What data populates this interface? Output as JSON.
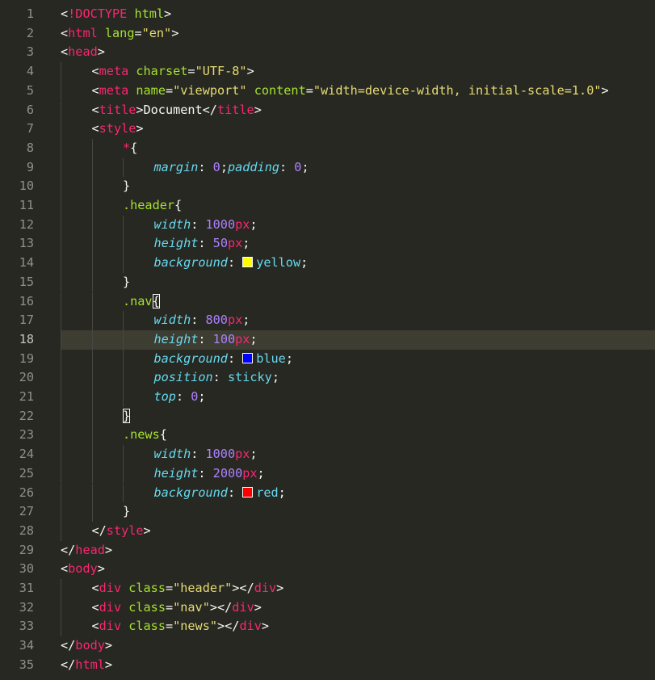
{
  "editor": {
    "active_line": 18,
    "colors": {
      "background": "#272822",
      "tag": "#f92672",
      "attribute": "#a6e22e",
      "string": "#e6db74",
      "number": "#ae81ff",
      "property": "#66d9ef",
      "text": "#f8f8f2"
    },
    "lines": [
      {
        "n": "1",
        "indent": 0,
        "tokens": [
          [
            "plain",
            "<"
          ],
          [
            "tag",
            "!DOCTYPE"
          ],
          [
            "plain",
            " "
          ],
          [
            "attr",
            "html"
          ],
          [
            "plain",
            ">"
          ]
        ]
      },
      {
        "n": "2",
        "indent": 0,
        "tokens": [
          [
            "plain",
            "<"
          ],
          [
            "tag",
            "html"
          ],
          [
            "plain",
            " "
          ],
          [
            "attr",
            "lang"
          ],
          [
            "plain",
            "="
          ],
          [
            "str",
            "\"en\""
          ],
          [
            "plain",
            ">"
          ]
        ]
      },
      {
        "n": "3",
        "indent": 0,
        "tokens": [
          [
            "plain",
            "<"
          ],
          [
            "tag",
            "head"
          ],
          [
            "plain",
            ">"
          ]
        ]
      },
      {
        "n": "4",
        "indent": 1,
        "tokens": [
          [
            "plain",
            "<"
          ],
          [
            "tag",
            "meta"
          ],
          [
            "plain",
            " "
          ],
          [
            "attr",
            "charset"
          ],
          [
            "plain",
            "="
          ],
          [
            "str",
            "\"UTF-8\""
          ],
          [
            "plain",
            ">"
          ]
        ]
      },
      {
        "n": "5",
        "indent": 1,
        "tokens": [
          [
            "plain",
            "<"
          ],
          [
            "tag",
            "meta"
          ],
          [
            "plain",
            " "
          ],
          [
            "attr",
            "name"
          ],
          [
            "plain",
            "="
          ],
          [
            "str",
            "\"viewport\""
          ],
          [
            "plain",
            " "
          ],
          [
            "attr",
            "content"
          ],
          [
            "plain",
            "="
          ],
          [
            "str",
            "\"width=device-width, initial-scale=1.0\""
          ],
          [
            "plain",
            ">"
          ]
        ]
      },
      {
        "n": "6",
        "indent": 1,
        "tokens": [
          [
            "plain",
            "<"
          ],
          [
            "tag",
            "title"
          ],
          [
            "plain",
            ">Document</"
          ],
          [
            "tag",
            "title"
          ],
          [
            "plain",
            ">"
          ]
        ]
      },
      {
        "n": "7",
        "indent": 1,
        "tokens": [
          [
            "plain",
            "<"
          ],
          [
            "tag",
            "style"
          ],
          [
            "plain",
            ">"
          ]
        ]
      },
      {
        "n": "8",
        "indent": 2,
        "tokens": [
          [
            "tag",
            "*"
          ],
          [
            "plain",
            "{"
          ]
        ]
      },
      {
        "n": "9",
        "indent": 3,
        "tokens": [
          [
            "prop",
            "margin"
          ],
          [
            "plain",
            ": "
          ],
          [
            "num",
            "0"
          ],
          [
            "plain",
            ";"
          ],
          [
            "prop",
            "padding"
          ],
          [
            "plain",
            ": "
          ],
          [
            "num",
            "0"
          ],
          [
            "plain",
            ";"
          ]
        ]
      },
      {
        "n": "10",
        "indent": 2,
        "tokens": [
          [
            "plain",
            "}"
          ]
        ]
      },
      {
        "n": "11",
        "indent": 2,
        "tokens": [
          [
            "sel",
            ".header"
          ],
          [
            "plain",
            "{"
          ]
        ]
      },
      {
        "n": "12",
        "indent": 3,
        "tokens": [
          [
            "prop",
            "width"
          ],
          [
            "plain",
            ": "
          ],
          [
            "num",
            "1000"
          ],
          [
            "unit",
            "px"
          ],
          [
            "plain",
            ";"
          ]
        ]
      },
      {
        "n": "13",
        "indent": 3,
        "tokens": [
          [
            "prop",
            "height"
          ],
          [
            "plain",
            ": "
          ],
          [
            "num",
            "50"
          ],
          [
            "unit",
            "px"
          ],
          [
            "plain",
            ";"
          ]
        ]
      },
      {
        "n": "14",
        "indent": 3,
        "tokens": [
          [
            "prop",
            "background"
          ],
          [
            "plain",
            ": "
          ],
          [
            "swatch",
            "#ffff00"
          ],
          [
            "kw",
            "yellow"
          ],
          [
            "plain",
            ";"
          ]
        ]
      },
      {
        "n": "15",
        "indent": 2,
        "tokens": [
          [
            "plain",
            "}"
          ]
        ]
      },
      {
        "n": "16",
        "indent": 2,
        "tokens": [
          [
            "sel",
            ".nav"
          ],
          [
            "box",
            "{"
          ]
        ]
      },
      {
        "n": "17",
        "indent": 3,
        "tokens": [
          [
            "prop",
            "width"
          ],
          [
            "plain",
            ": "
          ],
          [
            "num",
            "800"
          ],
          [
            "unit",
            "px"
          ],
          [
            "plain",
            ";"
          ]
        ]
      },
      {
        "n": "18",
        "indent": 3,
        "tokens": [
          [
            "prop",
            "height"
          ],
          [
            "plain",
            ": "
          ],
          [
            "num",
            "100"
          ],
          [
            "unit",
            "px"
          ],
          [
            "plain",
            ";"
          ]
        ]
      },
      {
        "n": "19",
        "indent": 3,
        "tokens": [
          [
            "prop",
            "background"
          ],
          [
            "plain",
            ": "
          ],
          [
            "swatch",
            "#0000ff"
          ],
          [
            "kw",
            "blue"
          ],
          [
            "plain",
            ";"
          ]
        ]
      },
      {
        "n": "20",
        "indent": 3,
        "tokens": [
          [
            "prop",
            "position"
          ],
          [
            "plain",
            ": "
          ],
          [
            "kw",
            "sticky"
          ],
          [
            "plain",
            ";"
          ]
        ]
      },
      {
        "n": "21",
        "indent": 3,
        "tokens": [
          [
            "prop",
            "top"
          ],
          [
            "plain",
            ": "
          ],
          [
            "num",
            "0"
          ],
          [
            "plain",
            ";"
          ]
        ]
      },
      {
        "n": "22",
        "indent": 2,
        "tokens": [
          [
            "box",
            "}"
          ]
        ]
      },
      {
        "n": "23",
        "indent": 2,
        "tokens": [
          [
            "sel",
            ".news"
          ],
          [
            "plain",
            "{"
          ]
        ]
      },
      {
        "n": "24",
        "indent": 3,
        "tokens": [
          [
            "prop",
            "width"
          ],
          [
            "plain",
            ": "
          ],
          [
            "num",
            "1000"
          ],
          [
            "unit",
            "px"
          ],
          [
            "plain",
            ";"
          ]
        ]
      },
      {
        "n": "25",
        "indent": 3,
        "tokens": [
          [
            "prop",
            "height"
          ],
          [
            "plain",
            ": "
          ],
          [
            "num",
            "2000"
          ],
          [
            "unit",
            "px"
          ],
          [
            "plain",
            ";"
          ]
        ]
      },
      {
        "n": "26",
        "indent": 3,
        "tokens": [
          [
            "prop",
            "background"
          ],
          [
            "plain",
            ": "
          ],
          [
            "swatch",
            "#ff0000"
          ],
          [
            "kw",
            "red"
          ],
          [
            "plain",
            ";"
          ]
        ]
      },
      {
        "n": "27",
        "indent": 2,
        "tokens": [
          [
            "plain",
            "}"
          ]
        ]
      },
      {
        "n": "28",
        "indent": 1,
        "tokens": [
          [
            "plain",
            "</"
          ],
          [
            "tag",
            "style"
          ],
          [
            "plain",
            ">"
          ]
        ]
      },
      {
        "n": "29",
        "indent": 0,
        "tokens": [
          [
            "plain",
            "</"
          ],
          [
            "tag",
            "head"
          ],
          [
            "plain",
            ">"
          ]
        ]
      },
      {
        "n": "30",
        "indent": 0,
        "tokens": [
          [
            "plain",
            "<"
          ],
          [
            "tag",
            "body"
          ],
          [
            "plain",
            ">"
          ]
        ]
      },
      {
        "n": "31",
        "indent": 1,
        "tokens": [
          [
            "plain",
            "<"
          ],
          [
            "tag",
            "div"
          ],
          [
            "plain",
            " "
          ],
          [
            "attr",
            "class"
          ],
          [
            "plain",
            "="
          ],
          [
            "str",
            "\"header\""
          ],
          [
            "plain",
            "></"
          ],
          [
            "tag",
            "div"
          ],
          [
            "plain",
            ">"
          ]
        ]
      },
      {
        "n": "32",
        "indent": 1,
        "tokens": [
          [
            "plain",
            "<"
          ],
          [
            "tag",
            "div"
          ],
          [
            "plain",
            " "
          ],
          [
            "attr",
            "class"
          ],
          [
            "plain",
            "="
          ],
          [
            "str",
            "\"nav\""
          ],
          [
            "plain",
            "></"
          ],
          [
            "tag",
            "div"
          ],
          [
            "plain",
            ">"
          ]
        ]
      },
      {
        "n": "33",
        "indent": 1,
        "tokens": [
          [
            "plain",
            "<"
          ],
          [
            "tag",
            "div"
          ],
          [
            "plain",
            " "
          ],
          [
            "attr",
            "class"
          ],
          [
            "plain",
            "="
          ],
          [
            "str",
            "\"news\""
          ],
          [
            "plain",
            "></"
          ],
          [
            "tag",
            "div"
          ],
          [
            "plain",
            ">"
          ]
        ]
      },
      {
        "n": "34",
        "indent": 0,
        "tokens": [
          [
            "plain",
            "</"
          ],
          [
            "tag",
            "body"
          ],
          [
            "plain",
            ">"
          ]
        ]
      },
      {
        "n": "35",
        "indent": 0,
        "tokens": [
          [
            "plain",
            "</"
          ],
          [
            "tag",
            "html"
          ],
          [
            "plain",
            ">"
          ]
        ]
      }
    ]
  }
}
